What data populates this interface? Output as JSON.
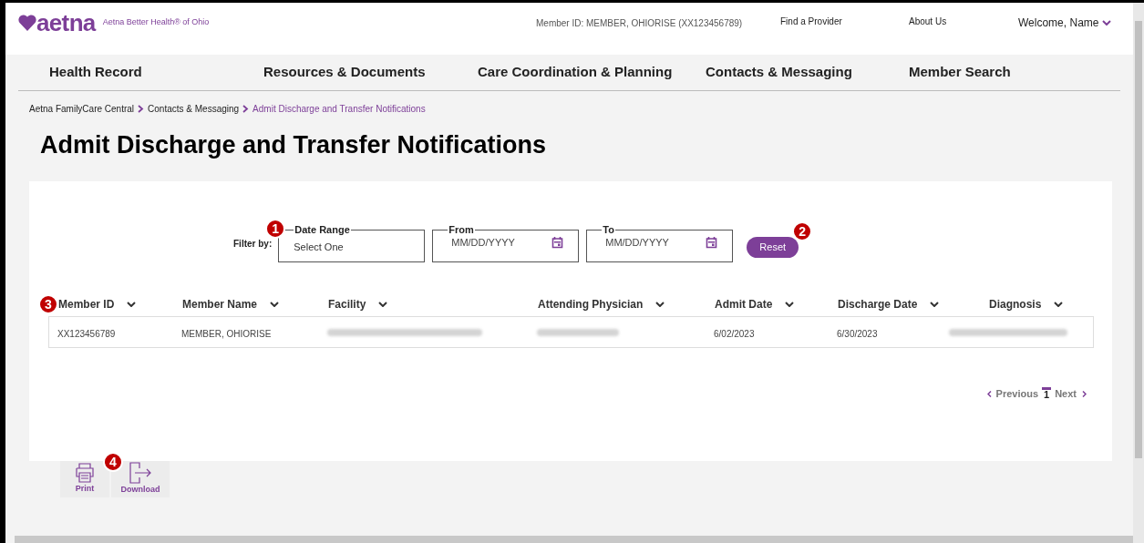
{
  "header": {
    "logo": "aetna",
    "brand": "Aetna Better Health® of Ohio",
    "member_id": "Member ID: MEMBER, OHIORISE (XX123456789)",
    "links": [
      "Find a Provider",
      "About Us"
    ],
    "user_menu": "Welcome, Name"
  },
  "nav": [
    {
      "label": "Health Record"
    },
    {
      "label": "Resources & Documents"
    },
    {
      "label": "Care Coordination & Planning"
    },
    {
      "label": "Contacts & Messaging"
    },
    {
      "label": "Member Search"
    }
  ],
  "breadcrumb": [
    {
      "label": "Aetna FamilyCare Central",
      "current": false
    },
    {
      "label": "Contacts & Messaging",
      "current": false
    },
    {
      "label": "Admit Discharge and Transfer Notifications",
      "current": true
    }
  ],
  "title": "Admit Discharge and Transfer Notifications",
  "filter": {
    "label": "Filter by:",
    "fields": [
      {
        "kind": "select",
        "legend": "Date Range",
        "placeholder": "Select One",
        "badge": "1"
      },
      {
        "kind": "date",
        "legend": "From",
        "placeholder": "MM/DD/YYYY"
      },
      {
        "kind": "date",
        "legend": "To",
        "placeholder": "MM/DD/YYYY"
      }
    ],
    "reset": {
      "label": "Reset",
      "badge": "2"
    }
  },
  "table": {
    "badge": "3",
    "columns": [
      "Member ID",
      "Member Name",
      "Facility",
      "Attending Physician",
      "Admit Date",
      "Discharge Date",
      "Diagnosis"
    ],
    "rows": [
      {
        "cells": [
          {
            "kind": "text",
            "text": "XX123456789"
          },
          {
            "kind": "text",
            "text": "MEMBER, OHIORISE"
          },
          {
            "kind": "redacted"
          },
          {
            "kind": "redacted"
          },
          {
            "kind": "text",
            "text": "6/02/2023"
          },
          {
            "kind": "text",
            "text": "6/30/2023"
          },
          {
            "kind": "redacted"
          }
        ]
      }
    ]
  },
  "pagination": {
    "previous": "Previous",
    "next": "Next",
    "pages": [
      {
        "label": "1",
        "selected": true
      }
    ]
  },
  "actions": {
    "badge": "4",
    "buttons": [
      {
        "kind": "print",
        "label": "Print"
      },
      {
        "kind": "download",
        "label": "Download"
      }
    ]
  }
}
